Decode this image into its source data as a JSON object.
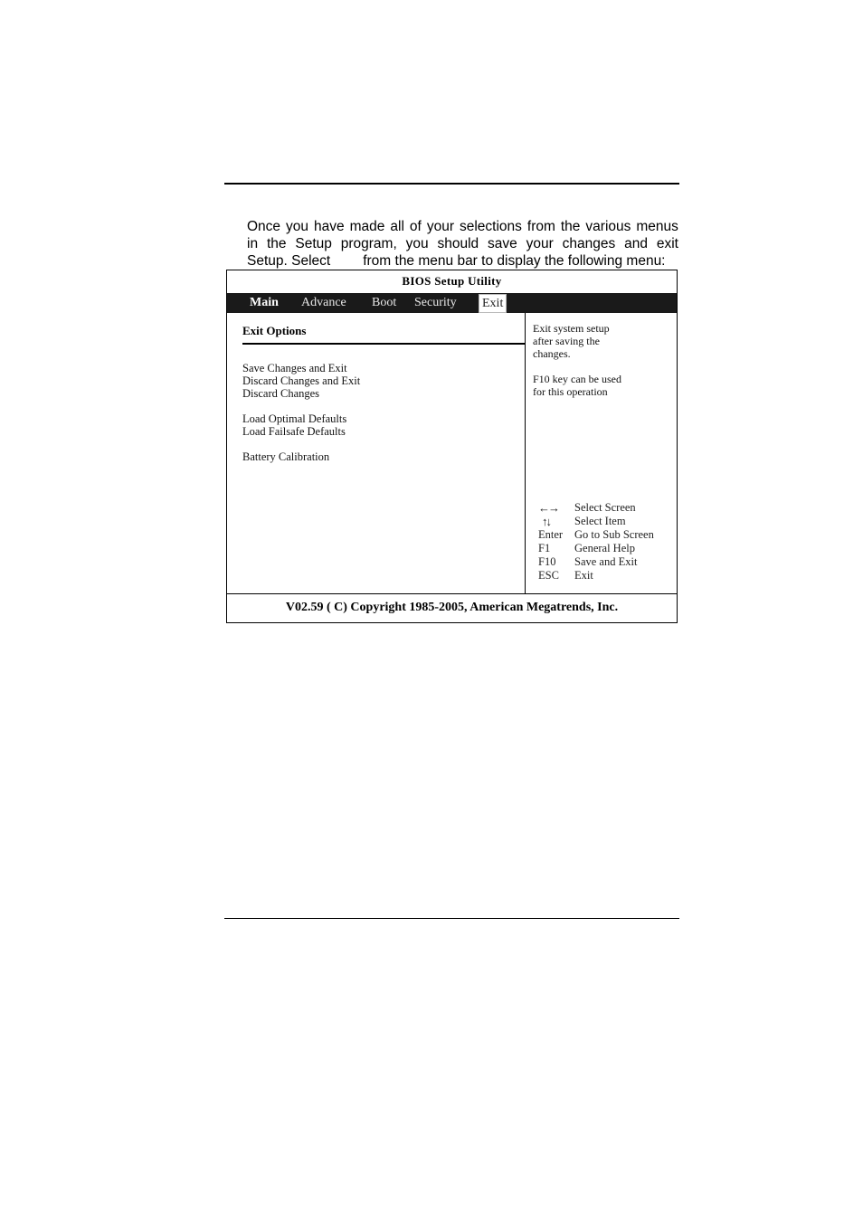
{
  "intro": {
    "line1": [
      "Once",
      "you",
      "have",
      "made",
      "all",
      "of",
      "your",
      "selections",
      "from",
      "the",
      "various",
      "menus"
    ],
    "line2": [
      "in",
      "the",
      "Setup",
      "program,",
      "you",
      "should",
      "save",
      "your",
      "changes",
      "and",
      "exit"
    ],
    "line3_a": "Setup.  Select",
    "line3_b": "from the menu bar to display the following menu:"
  },
  "bios": {
    "title": "BIOS Setup Utility",
    "menu": [
      "Main",
      "Advance",
      "Boot",
      "Security",
      "Exit"
    ],
    "selected_menu": "Exit",
    "section_title": "Exit Options",
    "options": [
      "Save Changes and Exit",
      "Discard Changes and Exit",
      "Discard Changes",
      "Load Optimal Defaults",
      "Load Failsafe Defaults",
      "Battery Calibration"
    ],
    "help_lines": [
      "Exit system setup",
      "after saving the",
      "changes.",
      "F10 key can be used",
      "for this operation"
    ],
    "keys": [
      {
        "key": "←→",
        "desc": "Select Screen"
      },
      {
        "key": "↑↓",
        "desc": "Select Item"
      },
      {
        "key": "Enter",
        "desc": "Go to Sub Screen"
      },
      {
        "key": "F1",
        "desc": "General Help"
      },
      {
        "key": "F10",
        "desc": "Save and Exit"
      },
      {
        "key": "ESC",
        "desc": "Exit"
      }
    ],
    "footer": "V02.59  ( C) Copyright 1985-2005, American Megatrends, Inc."
  }
}
